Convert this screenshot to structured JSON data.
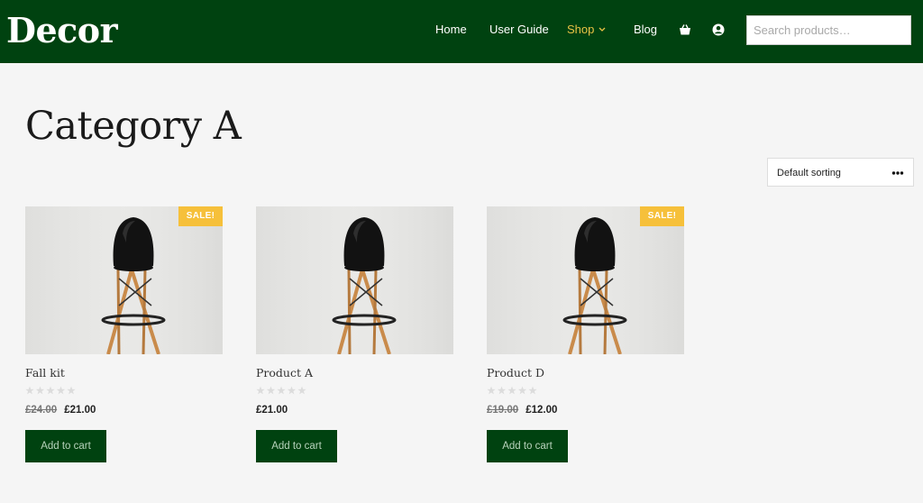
{
  "header": {
    "logo": "Decor",
    "nav": {
      "home": "Home",
      "user_guide": "User Guide",
      "shop": "Shop",
      "blog": "Blog"
    },
    "search_placeholder": "Search products…",
    "background_color": "#004210",
    "active_nav_color": "#e9c245"
  },
  "page": {
    "title": "Category A"
  },
  "sorting": {
    "selected": "Default sorting",
    "icon": "more-dots-icon"
  },
  "products": [
    {
      "title": "Fall kit",
      "sale_badge": "SALE!",
      "old_price": "£24.00",
      "price": "£21.00",
      "rating_stars": 0,
      "button": "Add to cart"
    },
    {
      "title": "Product A",
      "sale_badge": "",
      "old_price": "",
      "price": "£21.00",
      "rating_stars": 0,
      "button": "Add to cart"
    },
    {
      "title": "Product D",
      "sale_badge": "SALE!",
      "old_price": "£19.00",
      "price": "£12.00",
      "rating_stars": 0,
      "button": "Add to cart"
    }
  ],
  "colors": {
    "button": "#004210",
    "sale_badge": "#f6c03a"
  }
}
